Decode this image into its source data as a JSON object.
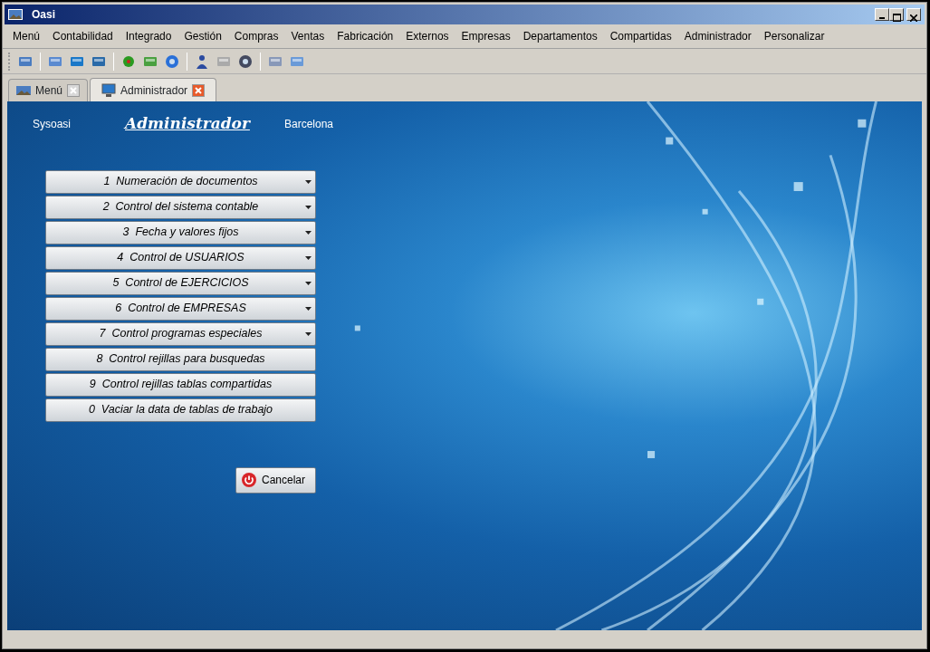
{
  "window": {
    "title": "Oasi"
  },
  "menu": [
    "Menú",
    "Contabilidad",
    "Integrado",
    "Gestión",
    "Compras",
    "Ventas",
    "Fabricación",
    "Externos",
    "Empresas",
    "Departamentos",
    "Compartidas",
    "Administrador",
    "Personalizar"
  ],
  "tabs": [
    {
      "label": "Menú",
      "selected": false
    },
    {
      "label": "Administrador",
      "selected": true
    }
  ],
  "header": {
    "user": "Sysoasi",
    "title": "Administrador",
    "location": "Barcelona"
  },
  "options": [
    {
      "label": "1  Numeración de documentos",
      "has_menu": true
    },
    {
      "label": "2  Control del sistema contable",
      "has_menu": true
    },
    {
      "label": "3  Fecha y valores fijos",
      "has_menu": true
    },
    {
      "label": "4  Control de USUARIOS",
      "has_menu": true
    },
    {
      "label": "5  Control de EJERCICIOS",
      "has_menu": true
    },
    {
      "label": "6  Control de EMPRESAS",
      "has_menu": true
    },
    {
      "label": "7  Control programas especiales",
      "has_menu": true
    },
    {
      "label": "8  Control rejillas para busquedas",
      "has_menu": false
    },
    {
      "label": "9  Control rejillas tablas compartidas",
      "has_menu": false
    },
    {
      "label": "0  Vaciar la data de tablas de trabajo",
      "has_menu": false
    }
  ],
  "cancel_button": "Cancelar"
}
